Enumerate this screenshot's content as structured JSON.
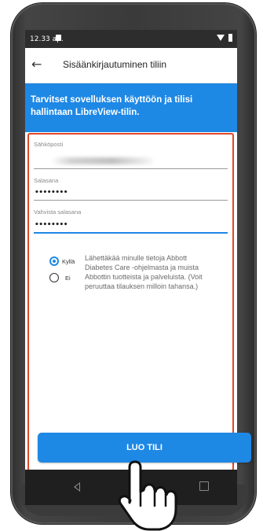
{
  "statusbar": {
    "time": "12.33 ap."
  },
  "appbar": {
    "back_icon": "arrow-left-icon",
    "title": "Sisäänkirjautuminen tiliin"
  },
  "banner": {
    "text": "Tarvitset sovelluksen käyttöön ja tilisi hallintaan LibreView-tilin."
  },
  "form": {
    "email_label": "Sähköposti",
    "password_label": "Salasana",
    "password_value": "••••••••",
    "confirm_label": "Vahvista salasana",
    "confirm_value": "••••••••"
  },
  "consent": {
    "yes_label": "Kyllä",
    "no_label": "Ei",
    "text": "Lähettäkää minulle tietoja Abbott Diabetes Care -ohjelmasta ja muista Abbottin tuotteista ja palveluista. (Voit peruuttaa tilauksen milloin tahansa.)",
    "selected": "Kyllä"
  },
  "cta": {
    "label": "LUO TILI"
  },
  "colors": {
    "accent": "#1e88e5",
    "highlight_border": "#e0472a"
  }
}
